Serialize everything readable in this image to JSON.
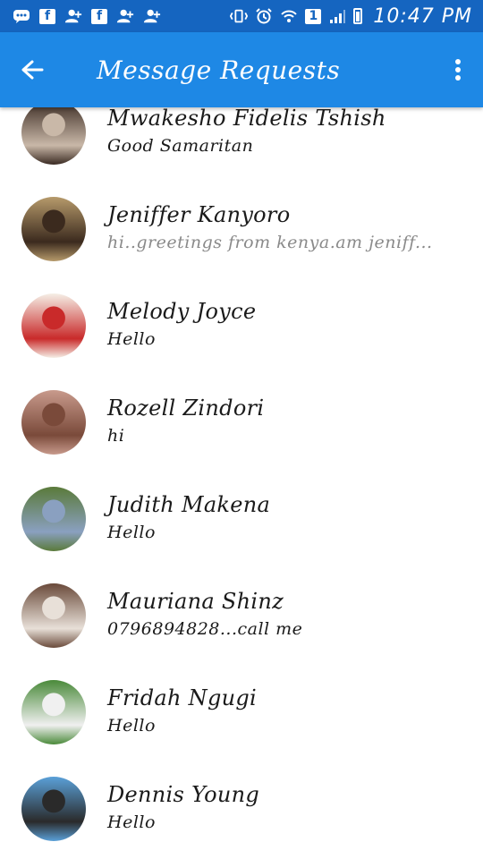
{
  "status_bar": {
    "time": "10:47 PM",
    "notification_icons": [
      "messenger-icon",
      "facebook-icon",
      "friend-request-icon",
      "facebook-icon",
      "friend-request-icon",
      "friend-request-icon"
    ],
    "sim_label": "1"
  },
  "app_bar": {
    "title": "Message Requests",
    "background": "#1e88e5"
  },
  "requests": [
    {
      "name": "Mwakesho Fidelis Tshish",
      "message": "Good Samaritan",
      "unread": true,
      "avatar_colors": [
        "#3a2a22",
        "#c9b8a8"
      ]
    },
    {
      "name": "Jeniffer Kanyoro",
      "message": "hi..greetings from kenya.am jeniff...",
      "unread": false,
      "avatar_colors": [
        "#b69a6b",
        "#3b2a1e"
      ]
    },
    {
      "name": "Melody Joyce",
      "message": "Hello",
      "unread": true,
      "avatar_colors": [
        "#f5efe6",
        "#c92a2a"
      ]
    },
    {
      "name": "Rozell Zindori",
      "message": "hi",
      "unread": true,
      "avatar_colors": [
        "#c89a8c",
        "#7a4a3a"
      ]
    },
    {
      "name": "Judith Makena",
      "message": "Hello",
      "unread": true,
      "avatar_colors": [
        "#5a7a3a",
        "#8aa0c0"
      ]
    },
    {
      "name": "Mauriana Shinz",
      "message": "0796894828...call me",
      "unread": true,
      "avatar_colors": [
        "#6a4a3a",
        "#e8e0d8"
      ]
    },
    {
      "name": "Fridah Ngugi",
      "message": "Hello",
      "unread": true,
      "avatar_colors": [
        "#4a8a3a",
        "#f0f0f0"
      ]
    },
    {
      "name": "Dennis Young",
      "message": "Hello",
      "unread": true,
      "avatar_colors": [
        "#5aa0d8",
        "#2a2a2a"
      ]
    }
  ]
}
